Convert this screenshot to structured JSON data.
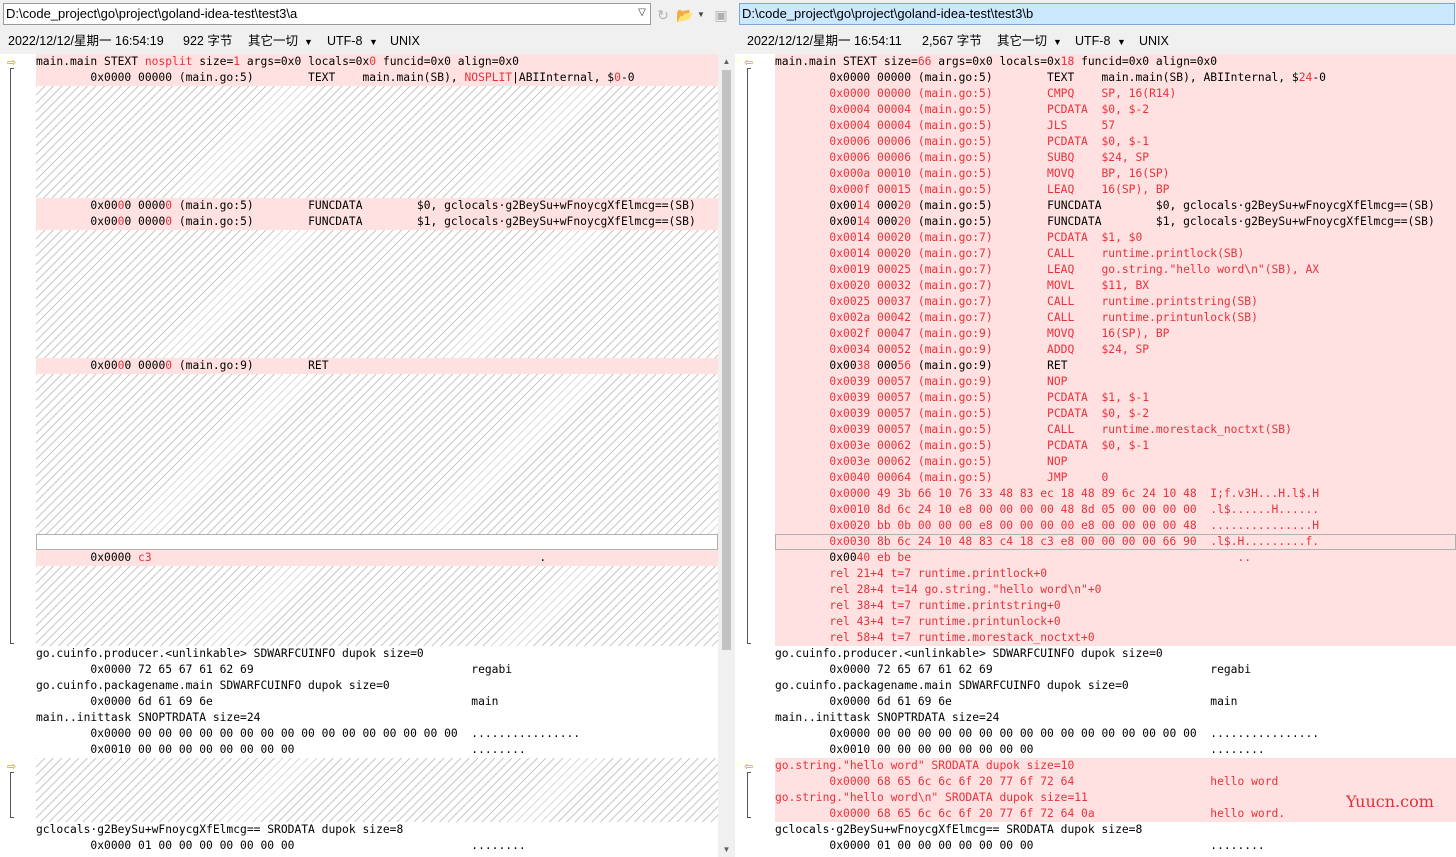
{
  "left": {
    "path": "D:\\code_project\\go\\project\\goland-idea-test\\test3\\a",
    "info": {
      "datetime": "2022/12/12/星期一 16:54:19",
      "size": "922 字节",
      "encoding_hint": "其它一切",
      "charset": "UTF-8",
      "eol": "UNIX"
    },
    "lines": [
      {
        "plain": "main.main STEXT "
      },
      {
        "red": "nosplit"
      },
      {
        "plain": " size="
      },
      {
        "red": "1"
      },
      {
        "plain": " args=0x0 locals=0x"
      },
      {
        "red": "0"
      },
      {
        "plain": " funcid=0x0 align=0x0"
      }
    ],
    "l2": [
      "        0x0000 00000 (main.go:5)        TEXT    main.main(SB), ",
      "NOSPLIT",
      "|ABIInternal, $",
      "0",
      "-0"
    ],
    "l3": [
      "        0x00",
      "0",
      "0 0000",
      "0",
      " (main.go:5)        FUNCDATA        $0, gclocals·g2BeySu+wFnoycgXfElmcg==(SB)"
    ],
    "l4": [
      "        0x00",
      "0",
      "0 0000",
      "0",
      " (main.go:5)        FUNCDATA        $1, gclocals·g2BeySu+wFnoycgXfElmcg==(SB)"
    ],
    "l5": [
      "        0x00",
      "0",
      "0 0000",
      "0",
      " (main.go:9)        RET"
    ],
    "l6": [
      "        0x0000 ",
      "c3",
      "                                                         ."
    ],
    "common": [
      "go.cuinfo.producer.<unlinkable> SDWARFCUINFO dupok size=0",
      "        0x0000 72 65 67 61 62 69                                regabi",
      "go.cuinfo.packagename.main SDWARFCUINFO dupok size=0",
      "        0x0000 6d 61 69 6e                                      main",
      "main..inittask SNOPTRDATA size=24",
      "        0x0000 00 00 00 00 00 00 00 00 00 00 00 00 00 00 00 00  ................",
      "        0x0010 00 00 00 00 00 00 00 00                          ........"
    ],
    "tail": [
      "gclocals·g2BeySu+wFnoycgXfElmcg== SRODATA dupok size=8",
      "        0x0000 01 00 00 00 00 00 00 00                          ........"
    ]
  },
  "right": {
    "path": "D:\\code_project\\go\\project\\goland-idea-test\\test3\\b",
    "info": {
      "datetime": "2022/12/12/星期一 16:54:11",
      "size": "2,567 字节",
      "encoding_hint": "其它一切",
      "charset": "UTF-8",
      "eol": "UNIX"
    },
    "lines": [
      [
        "main.main STEXT size=",
        "66",
        " args=0x0 locals=0x",
        "18",
        " funcid=0x0 align=0x0"
      ],
      [
        "        0x0000 00000 (main.go:5)        TEXT    main.main(SB), ABIInternal, $",
        "24",
        "-0"
      ],
      [
        "",
        "        0x0000 00000 (main.go:5)        CMPQ    SP, 16(R14)"
      ],
      [
        "",
        "        0x0004 00004 (main.go:5)        PCDATA  $0, $-2"
      ],
      [
        "",
        "        0x0004 00004 (main.go:5)        JLS     57"
      ],
      [
        "",
        "        0x0006 00006 (main.go:5)        PCDATA  $0, $-1"
      ],
      [
        "",
        "        0x0006 00006 (main.go:5)        SUBQ    $24, SP"
      ],
      [
        "",
        "        0x000a 00010 (main.go:5)        MOVQ    BP, 16(SP)"
      ],
      [
        "",
        "        0x000f 00015 (main.go:5)        LEAQ    16(SP), BP"
      ],
      [
        "        0x00",
        "14",
        " 000",
        "20",
        " (main.go:5)        FUNCDATA        $0, gclocals·g2BeySu+wFnoycgXfElmcg==(SB)"
      ],
      [
        "        0x00",
        "14",
        " 000",
        "20",
        " (main.go:5)        FUNCDATA        $1, gclocals·g2BeySu+wFnoycgXfElmcg==(SB)"
      ],
      [
        "",
        "        0x0014 00020 (main.go:7)        PCDATA  $1, $0"
      ],
      [
        "",
        "        0x0014 00020 (main.go:7)        CALL    runtime.printlock(SB)"
      ],
      [
        "",
        "        0x0019 00025 (main.go:7)        LEAQ    go.string.\"hello word\\n\"(SB), AX"
      ],
      [
        "",
        "        0x0020 00032 (main.go:7)        MOVL    $11, BX"
      ],
      [
        "",
        "        0x0025 00037 (main.go:7)        CALL    runtime.printstring(SB)"
      ],
      [
        "",
        "        0x002a 00042 (main.go:7)        CALL    runtime.printunlock(SB)"
      ],
      [
        "",
        "        0x002f 00047 (main.go:9)        MOVQ    16(SP), BP"
      ],
      [
        "",
        "        0x0034 00052 (main.go:9)        ADDQ    $24, SP"
      ],
      [
        "        0x00",
        "38",
        " 000",
        "56",
        " (main.go:9)        RET"
      ],
      [
        "",
        "        0x0039 00057 (main.go:9)        NOP"
      ],
      [
        "",
        "        0x0039 00057 (main.go:5)        PCDATA  $1, $-1"
      ],
      [
        "",
        "        0x0039 00057 (main.go:5)        PCDATA  $0, $-2"
      ],
      [
        "",
        "        0x0039 00057 (main.go:5)        CALL    runtime.morestack_noctxt(SB)"
      ],
      [
        "",
        "        0x003e 00062 (main.go:5)        PCDATA  $0, $-1"
      ],
      [
        "",
        "        0x003e 00062 (main.go:5)        NOP"
      ],
      [
        "",
        "        0x0040 00064 (main.go:5)        JMP     0"
      ],
      [
        "",
        "        0x0000 49 3b 66 10 76 33 48 83 ec 18 48 89 6c 24 10 48  I;f.v3H...H.l$.H"
      ],
      [
        "",
        "        0x0010 8d 6c 24 10 e8 00 00 00 00 48 8d 05 00 00 00 00  .l$......H......"
      ],
      [
        "",
        "        0x0020 bb 0b 00 00 00 e8 00 00 00 00 e8 00 00 00 00 48  ...............H"
      ],
      [
        "",
        "        0x0030 8b 6c 24 10 48 83 c4 18 c3 e8 00 00 00 00 66 90  .l$.H.........f."
      ],
      [
        "        0x00",
        "40 eb be                                                .."
      ],
      [
        "",
        "        rel 21+4 t=7 runtime.printlock+0"
      ],
      [
        "",
        "        rel 28+4 t=14 go.string.\"hello word\\n\"+0"
      ],
      [
        "",
        "        rel 38+4 t=7 runtime.printstring+0"
      ],
      [
        "",
        "        rel 43+4 t=7 runtime.printunlock+0"
      ],
      [
        "",
        "        rel 58+4 t=7 runtime.morestack_noctxt+0"
      ]
    ],
    "common": [
      "go.cuinfo.producer.<unlinkable> SDWARFCUINFO dupok size=0",
      "        0x0000 72 65 67 61 62 69                                regabi",
      "go.cuinfo.packagename.main SDWARFCUINFO dupok size=0",
      "        0x0000 6d 61 69 6e                                      main",
      "main..inittask SNOPTRDATA size=24",
      "        0x0000 00 00 00 00 00 00 00 00 00 00 00 00 00 00 00 00  ................",
      "        0x0010 00 00 00 00 00 00 00 00                          ........"
    ],
    "strings": [
      "go.string.\"hello word\" SRODATA dupok size=10",
      "        0x0000 68 65 6c 6c 6f 20 77 6f 72 64                    hello word",
      "go.string.\"hello word\\n\" SRODATA dupok size=11",
      "        0x0000 68 65 6c 6c 6f 20 77 6f 72 64 0a                 hello word."
    ],
    "tail": [
      "gclocals·g2BeySu+wFnoycgXfElmcg== SRODATA dupok size=8",
      "        0x0000 01 00 00 00 00 00 00 00                          ........"
    ]
  },
  "watermark": "Yuucn.com",
  "colors": {
    "diff_bg": "#ffe1e1",
    "diff_text": "#e8323a",
    "active_path_bg": "#cce8ff"
  }
}
